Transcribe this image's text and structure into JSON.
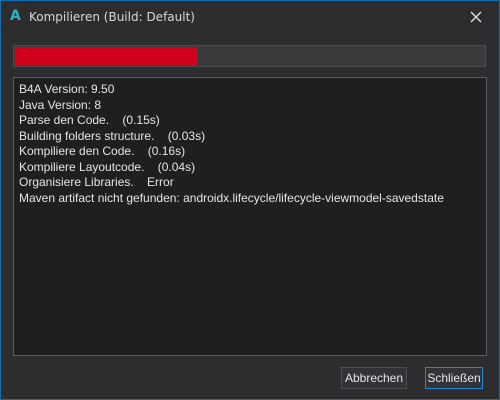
{
  "window": {
    "title": "Kompilieren (Build: Default)",
    "app_icon_glyph": "A",
    "app_icon_name": "b4a-app-icon",
    "close_icon_name": "close-icon"
  },
  "progress": {
    "fraction": 0.39,
    "fill_color": "#d0021b",
    "track_color": "#3a3a3d"
  },
  "log": {
    "lines": [
      "B4A Version: 9.50",
      "Java Version: 8",
      "Parse den Code.    (0.15s)",
      "Building folders structure.    (0.03s)",
      "Kompiliere den Code.    (0.16s)",
      "Kompiliere Layoutcode.    (0.04s)",
      "Organisiere Libraries.    Error",
      "Maven artifact nicht gefunden: androidx.lifecycle/lifecycle-viewmodel-savedstate"
    ]
  },
  "buttons": {
    "cancel_label": "Abbrechen",
    "close_label": "Schließen"
  },
  "colors": {
    "accent": "#22b5c8",
    "focus_border": "#1e87d6",
    "background": "#2d2d30",
    "log_background": "#1f1f1f"
  }
}
